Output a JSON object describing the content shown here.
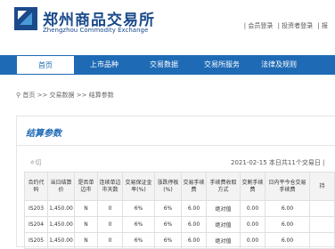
{
  "header": {
    "logo_cn": "郑州商品交易所",
    "logo_en": "Zhengzhou Commodity Exchange",
    "top_links": [
      "| 会员登录",
      "| 投资者登录",
      "| 报"
    ]
  },
  "nav": {
    "items": [
      {
        "label": "首页",
        "active": true
      },
      {
        "label": "上市品种",
        "active": false
      },
      {
        "label": "交易数据",
        "active": false
      },
      {
        "label": "交易所服务",
        "active": false
      },
      {
        "label": "法律及规则",
        "active": false
      },
      {
        "label": "",
        "active": false
      }
    ]
  },
  "breadcrumb": "首页 >> 交易数据 >> 结算参数",
  "content": {
    "title": "结算参数",
    "left_meta": "ㅎ切",
    "date_meta": "2021-02-15 本日共11个交易日 |"
  },
  "table": {
    "headers": [
      "合约代码",
      "当日结算价",
      "是否单边市",
      "连续单边市天数",
      "交易保证金率(%)",
      "涨跌停板(%)",
      "交易手续费",
      "手续费收取方式",
      "交割手续费",
      "日内平今仓交易手续费",
      "持"
    ],
    "rows": [
      [
        "IS203",
        "1,450.00",
        "N",
        "0",
        "6%",
        "6%",
        "6.00",
        "绝对值",
        "0.00",
        "6.00",
        ""
      ],
      [
        "IS204",
        "1,450.00",
        "N",
        "0",
        "6%",
        "6%",
        "6.00",
        "绝对值",
        "0.00",
        "6.00",
        ""
      ],
      [
        "IS205",
        "1,450.00",
        "N",
        "0",
        "6%",
        "6%",
        "6.00",
        "绝对值",
        "0.00",
        "6.00",
        ""
      ]
    ]
  }
}
